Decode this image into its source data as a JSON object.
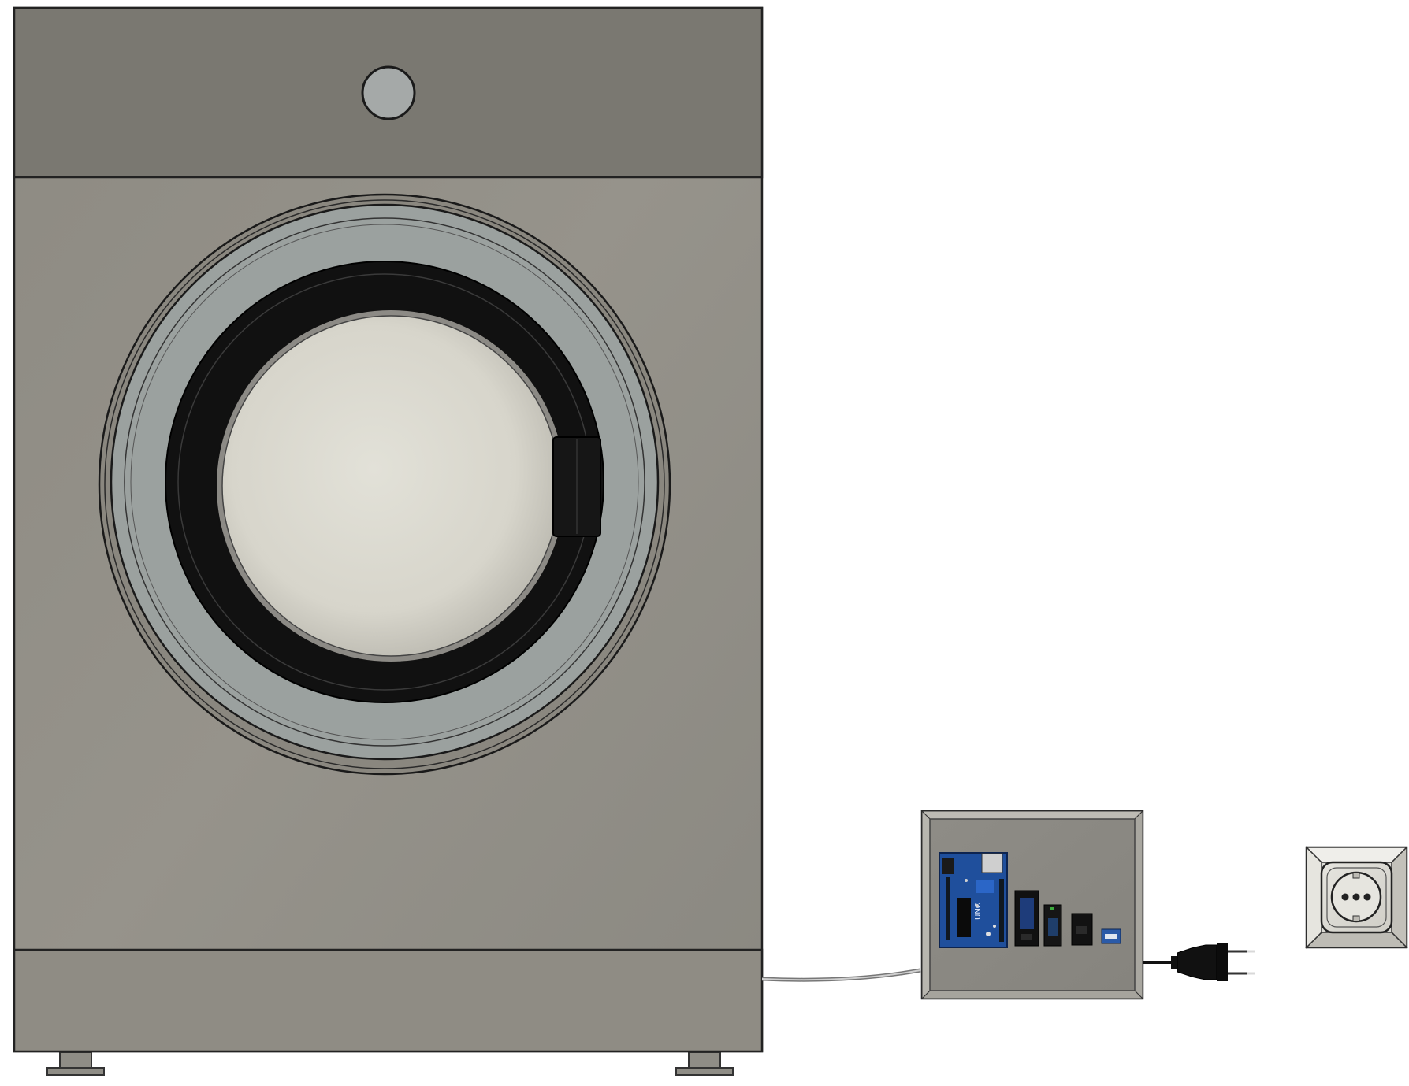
{
  "scene": {
    "background": "#ffffff",
    "objects": [
      "washing-machine",
      "control-box",
      "power-cable",
      "power-plug",
      "wall-socket"
    ]
  },
  "washing_machine": {
    "body_color": "#8f8c84",
    "top_panel_color": "#797770",
    "knob_color": "#a5a9a8",
    "door_ring_color": "#9aa09e",
    "door_gasket_color": "#121212",
    "door_glass_color": "#dcdbd2"
  },
  "control_box": {
    "color": "#8b8983",
    "components": [
      "arduino-board",
      "module-1",
      "module-2",
      "module-3",
      "usb-module"
    ],
    "board_color": "#1f4f9c"
  },
  "plug": {
    "type": "europlug",
    "color": "#111111"
  },
  "socket": {
    "type": "schuko",
    "color": "#e0dfd9"
  }
}
